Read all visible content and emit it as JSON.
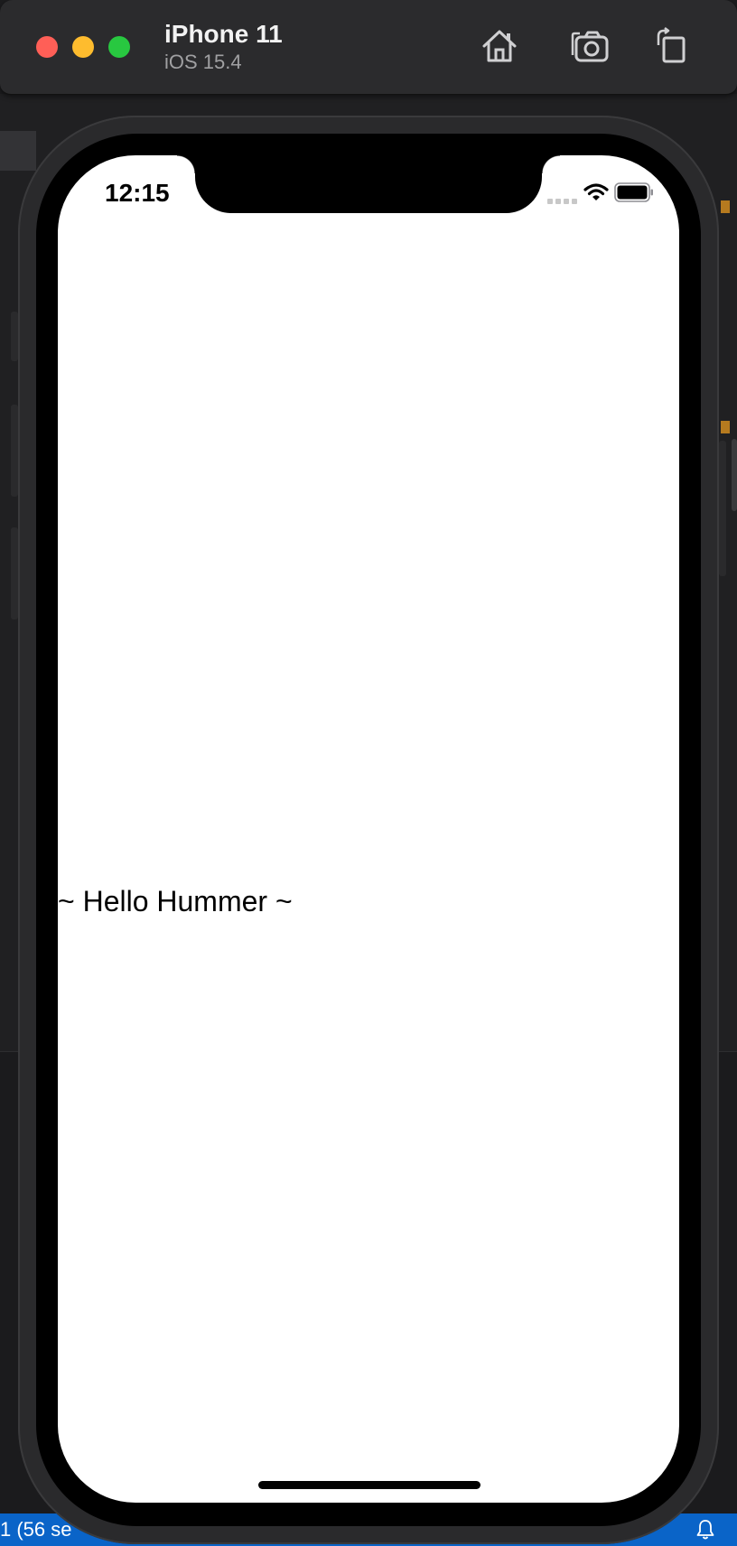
{
  "simulator": {
    "device_name": "iPhone 11",
    "os_version": "iOS 15.4",
    "home_icon": "home-icon",
    "screenshot_icon": "camera-icon",
    "rotate_icon": "rotate-icon"
  },
  "phone_status_bar": {
    "time": "12:15",
    "signal_icon": "cellular-signal-icon",
    "wifi_icon": "wifi-icon",
    "battery_icon": "battery-icon"
  },
  "app": {
    "greeting": "~ Hello Hummer ~"
  },
  "editor_status_bar": {
    "text": "1 (56 se",
    "bell_icon": "bell-icon",
    "background_color": "#0a64c8"
  }
}
